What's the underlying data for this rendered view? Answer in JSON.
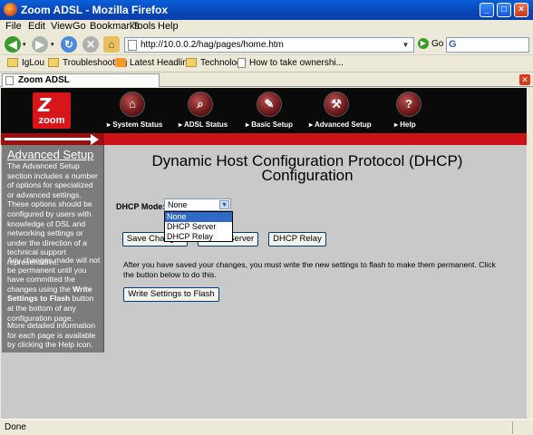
{
  "window": {
    "title": "Zoom ADSL - Mozilla Firefox"
  },
  "menu": [
    "File",
    "Edit",
    "View",
    "Go",
    "Bookmarks",
    "Tools",
    "Help"
  ],
  "navbar": {
    "url": "http://10.0.0.2/hag/pages/home.htm",
    "go_label": "Go",
    "search_glyph": "G"
  },
  "bookmarks": [
    "IgLou",
    "Troubleshooting",
    "Latest Headlines",
    "Technology",
    "How to take ownershi..."
  ],
  "tab": {
    "label": "Zoom ADSL"
  },
  "banner": {
    "logo_text": "zoom",
    "nav": [
      {
        "label": "▸ System Status",
        "icon": "system-status-icon",
        "glyph": "⌂"
      },
      {
        "label": "▸ ADSL Status",
        "icon": "adsl-status-icon",
        "glyph": "⌕"
      },
      {
        "label": "▸ Basic Setup",
        "icon": "basic-setup-icon",
        "glyph": "✎"
      },
      {
        "label": "▸ Advanced Setup",
        "icon": "advanced-setup-icon",
        "glyph": "⚒"
      },
      {
        "label": "▸ Help",
        "icon": "help-icon",
        "glyph": "?"
      }
    ]
  },
  "sidebar": {
    "heading": "Advanced Setup",
    "para1": "The Advanced Setup section includes a number of options for specialized or advanced settings. These options should be configured by users with knowledge of DSL and networking settings or under the direction of a technical support representative.",
    "para2_a": "Any changes made will not be permanent until you have committed the changes using the ",
    "para2_b": "Write Settings to Flash",
    "para2_c": " button at the bottom of any configuration page.",
    "para3": "More detailed information for each page is available by clicking the Help icon."
  },
  "main": {
    "title": "Dynamic Host Configuration Protocol (DHCP) Configuration",
    "dhcp_mode_label": "DHCP Mode:",
    "dhcp_mode_value": "None",
    "dhcp_options": [
      "None",
      "DHCP Server",
      "DHCP Relay"
    ],
    "save_changes": "Save Changes",
    "dhcp_server_btn": "DHCP Server",
    "dhcp_relay_btn": "DHCP Relay",
    "instructions": "After you have saved your changes, you must write the new settings to flash to make them permanent. Click the button below to do this.",
    "write_flash": "Write Settings to Flash"
  },
  "status": {
    "text": "Done"
  },
  "colors": {
    "banner_red": "#cc1216",
    "sidebar_gray": "#7c7c7c",
    "page_bg": "#c9c9c9",
    "selection_blue": "#316ac5"
  }
}
